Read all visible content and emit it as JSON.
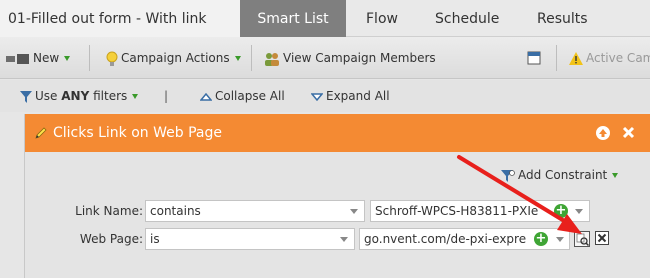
{
  "tabs": {
    "program_name": "01-Filled out form - With link",
    "smart_list": "Smart List",
    "flow": "Flow",
    "schedule": "Schedule",
    "results": "Results"
  },
  "toolbar": {
    "new_label": "New",
    "campaign_actions_label": "Campaign Actions",
    "view_members_label": "View Campaign Members",
    "active_label": "Active Cam"
  },
  "filterbar": {
    "use_label": "Use",
    "any_label": "ANY",
    "filters_label": "filters",
    "pipe": "|",
    "collapse_label": "Collapse All",
    "expand_label": "Expand All"
  },
  "filter_card": {
    "title": "Clicks Link on Web Page",
    "add_constraint_label": "Add Constraint",
    "rows": [
      {
        "label": "Link Name:",
        "operator": "contains",
        "value": "Schroff-WPCS-H83811-PXIe"
      },
      {
        "label": "Web Page:",
        "operator": "is",
        "value": "go.nvent.com/de-pxi-expre"
      }
    ]
  },
  "colors": {
    "header_orange": "#f48a33",
    "active_tab": "#7f7f7f",
    "annotation_arrow": "#e8201c",
    "add_green": "#3fa535"
  },
  "icons": [
    "new-icon",
    "lightbulb-icon",
    "people-icon",
    "calendar-icon",
    "warning-icon",
    "filter-icon",
    "collapse-icon",
    "expand-icon",
    "pencil-icon",
    "up-arrow-icon",
    "close-icon",
    "add-icon",
    "picker-icon",
    "delete-icon"
  ]
}
